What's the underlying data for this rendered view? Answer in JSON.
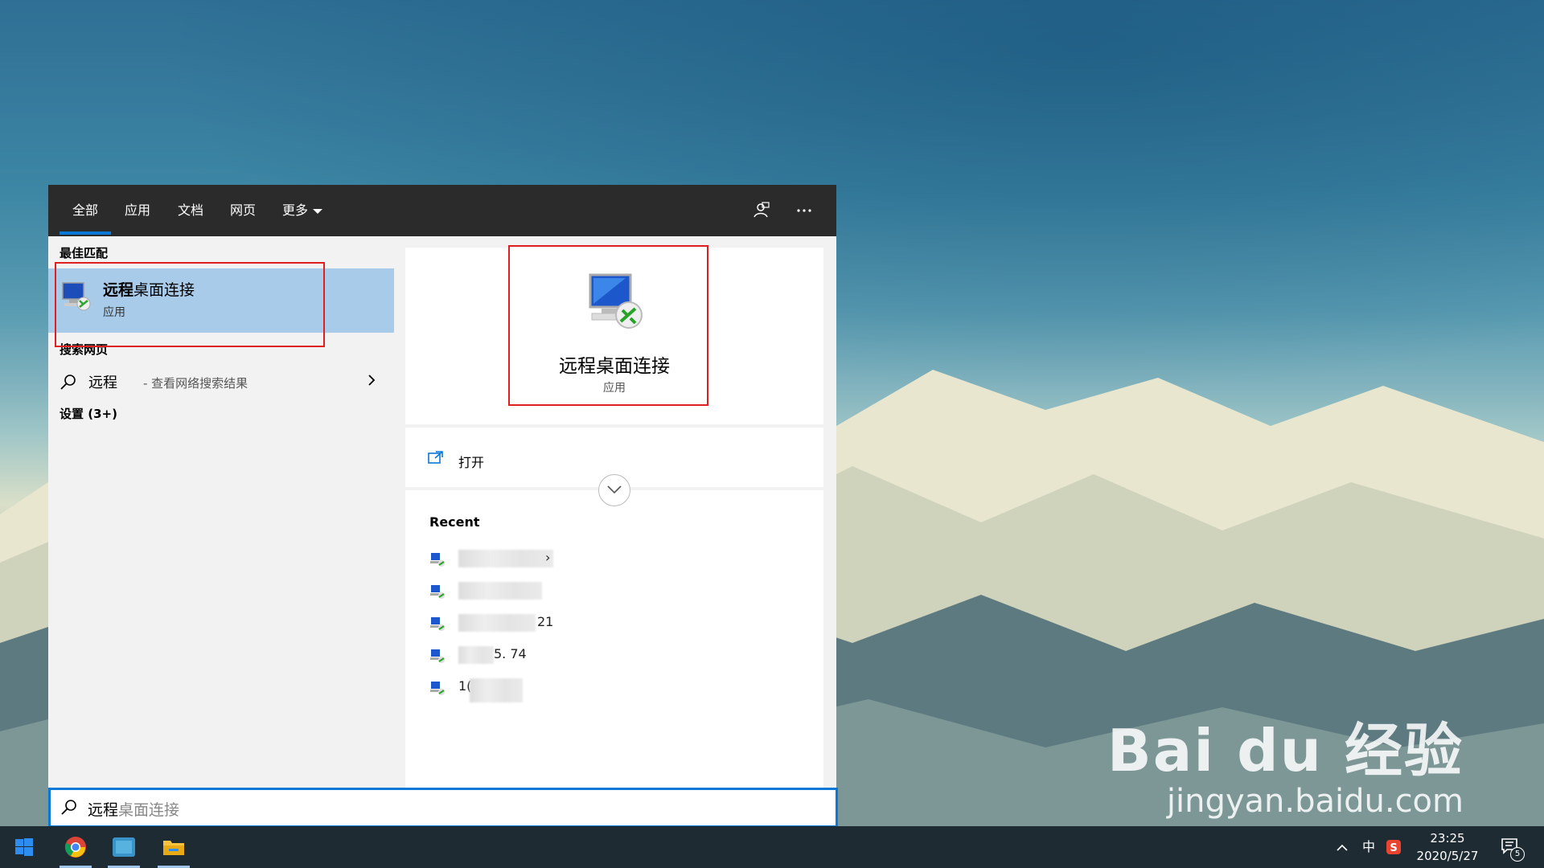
{
  "tabs": [
    {
      "label": "全部"
    },
    {
      "label": "应用"
    },
    {
      "label": "文档"
    },
    {
      "label": "网页"
    },
    {
      "label": "更多"
    }
  ],
  "left": {
    "best_match_header": "最佳匹配",
    "best_match": {
      "title_bold": "远程",
      "title_rest": "桌面连接",
      "subtitle": "应用"
    },
    "web_header": "搜索网页",
    "web_result": {
      "query": "远程",
      "hint": "- 查看网络搜索结果"
    },
    "settings_header": "设置 (3+)"
  },
  "right": {
    "app_title": "远程桌面连接",
    "app_subtitle": "应用",
    "open_label": "打开",
    "recent_header": "Recent",
    "recent_items": [
      {
        "visible_text": "›"
      },
      {
        "visible_text": ""
      },
      {
        "visible_text": "21"
      },
      {
        "visible_text": "5.        74"
      },
      {
        "visible_text": "1(        3"
      }
    ]
  },
  "search": {
    "typed": "远程",
    "suggestion": "桌面连接"
  },
  "taskbar": {
    "tray_ime": "中",
    "time": "23:25",
    "date": "2020/5/27",
    "notification_count": "5"
  },
  "watermark": {
    "logo": "Bai du 经验",
    "url": "jingyan.baidu.com"
  },
  "colors": {
    "accent": "#0a78d7",
    "highlight": "#a9cbea",
    "annotation": "#e02020"
  }
}
